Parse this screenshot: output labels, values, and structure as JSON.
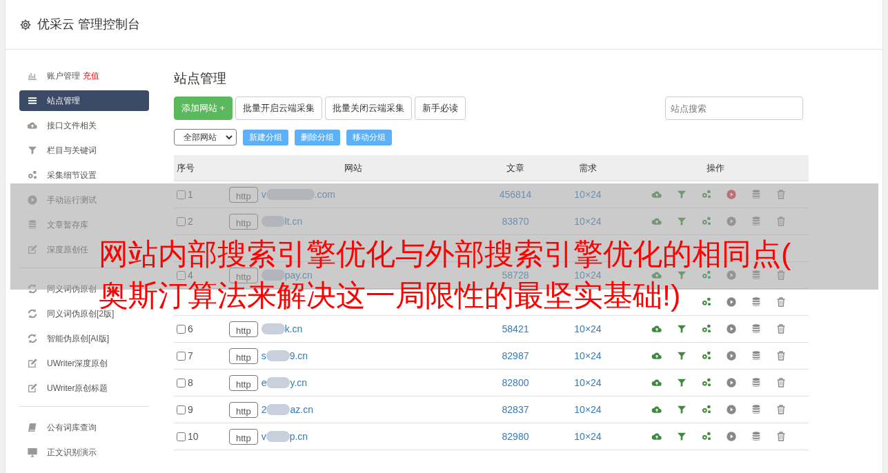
{
  "header": {
    "title": "优采云 管理控制台"
  },
  "sidebar": {
    "groups": [
      [
        {
          "label": "账户管理",
          "badge": "充值",
          "selected": false
        },
        {
          "label": "站点管理",
          "selected": true
        },
        {
          "label": "接口文件相关",
          "selected": false
        },
        {
          "label": "栏目与关键词",
          "selected": false
        },
        {
          "label": "采集细节设置",
          "selected": false
        },
        {
          "label": "手动运行测试",
          "selected": false
        },
        {
          "label": "文章暂存库",
          "selected": false
        },
        {
          "label": "深度原创任",
          "selected": false
        }
      ],
      [
        {
          "label": "同义词伪原创",
          "selected": false
        },
        {
          "label": "同义词伪原创[2版]",
          "selected": false
        },
        {
          "label": "智能伪原创[AI版]",
          "selected": false
        },
        {
          "label": "UWriter深度原创",
          "selected": false
        },
        {
          "label": "UWriter原创标题",
          "selected": false
        }
      ],
      [
        {
          "label": "公有词库查询",
          "selected": false
        },
        {
          "label": "正文识别演示",
          "selected": false
        }
      ]
    ]
  },
  "main": {
    "title": "站点管理",
    "buttons": [
      {
        "label": "添加网站 +",
        "kind": "primary"
      },
      {
        "label": "批量开启云端采集",
        "kind": "default"
      },
      {
        "label": "批量关闭云端采集",
        "kind": "default"
      },
      {
        "label": "新手必读",
        "kind": "default"
      }
    ],
    "search": {
      "placeholder": "站点搜索"
    },
    "group_select": {
      "value": "全部网站"
    },
    "group_buttons": [
      "新建分组",
      "删除分组",
      "移动分组"
    ],
    "table": {
      "columns": [
        "序号",
        "网站",
        "文章",
        "需求",
        "操作"
      ],
      "rows": [
        {
          "index": "1",
          "checked": false,
          "protocol": "http",
          "domain_start": "v",
          "domain_end": ".com",
          "articles": "456814",
          "demand": "10×24",
          "running": true
        },
        {
          "index": "2",
          "checked": false,
          "protocol": "http",
          "domain_start": "",
          "domain_end": "lt.cn",
          "articles": "83870",
          "demand": "10×24",
          "running": false
        },
        {},
        {
          "index": "4",
          "checked": false,
          "protocol": "http",
          "domain_start": "",
          "domain_end": "pay.cn",
          "articles": "58728",
          "demand": "10×24",
          "running": false
        },
        {
          "running": false
        },
        {
          "index": "6",
          "checked": false,
          "protocol": "http",
          "domain_start": "",
          "domain_end": "k.cn",
          "articles": "58421",
          "demand": "10×24",
          "running": false
        },
        {
          "index": "7",
          "checked": false,
          "protocol": "http",
          "domain_start": "s",
          "domain_end": "9.cn",
          "articles": "82987",
          "demand": "10×24",
          "running": false
        },
        {
          "index": "8",
          "checked": false,
          "protocol": "http",
          "domain_start": "e",
          "domain_end": "y.cn",
          "articles": "82800",
          "demand": "10×24",
          "running": false
        },
        {
          "index": "9",
          "checked": false,
          "protocol": "http",
          "domain_start": "2",
          "domain_end": "az.cn",
          "articles": "82837",
          "demand": "10×24",
          "running": false
        },
        {
          "index": "10",
          "checked": false,
          "protocol": "http",
          "domain_start": "v",
          "domain_end": "p.cn",
          "articles": "82980",
          "demand": "10×24",
          "running": false
        }
      ]
    }
  },
  "overlay_banner": {
    "lines": [
      "网站内部搜索引擎优化与外部搜索引擎优化的相同点(",
      "奥斯汀算法来解决这一局限性的最坚实基础!)"
    ]
  }
}
